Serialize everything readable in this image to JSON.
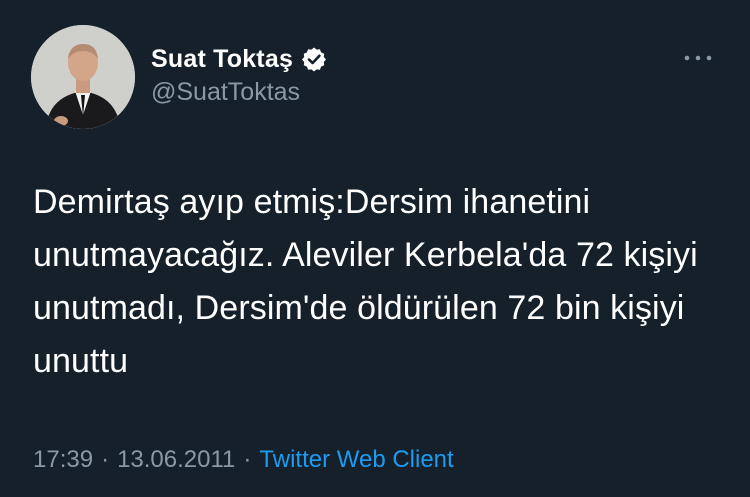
{
  "author": {
    "display_name": "Suat Toktaş",
    "handle": "@SuatToktas",
    "verified": true
  },
  "tweet": {
    "text": "Demirtaş ayıp etmiş:Dersim ihanetini unutmayacağız. Aleviler Kerbela'da 72 kişiyi unutmadı, Dersim'de öldürülen 72 bin kişiyi unuttu",
    "time": "17:39",
    "date": "13.06.2011",
    "separator": "·",
    "client": "Twitter Web Client"
  },
  "icons": {
    "more": "more-dots-icon",
    "verified": "verified-badge-icon"
  },
  "colors": {
    "background": "#15202b",
    "primary_text": "#ffffff",
    "secondary_text": "#8b98a5",
    "accent": "#1d9bf0"
  }
}
